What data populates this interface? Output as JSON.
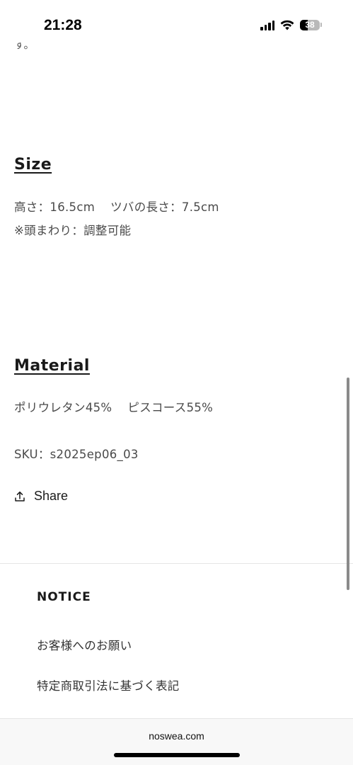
{
  "status_bar": {
    "time": "21:28",
    "battery_level": "38",
    "battery_fraction": 0.38
  },
  "description": {
    "clipped_text": "す。"
  },
  "size": {
    "heading": "Size",
    "height_label": "高さ：",
    "height_value": "16.5cm",
    "brim_label": "ツバの長さ：",
    "brim_value": "7.5cm",
    "note": "※頭まわり：調整可能"
  },
  "material": {
    "heading": "Material",
    "item1_name": "ポリウレタン",
    "item1_pct": "45%",
    "item2_name": "ピスコース",
    "item2_pct": "55%"
  },
  "sku": {
    "label": "SKU：",
    "value": "s2025ep06_03"
  },
  "share": {
    "label": "Share",
    "icon": "share-icon"
  },
  "footer": {
    "notice_title": "NOTICE",
    "links": [
      "お客様へのお願い",
      "特定商取引法に基づく表記"
    ]
  },
  "browser": {
    "url": "noswea.com"
  },
  "colors": {
    "heading": "#1a1a1a",
    "body_text": "#4a4a4a",
    "divider": "#e6e6e6"
  }
}
